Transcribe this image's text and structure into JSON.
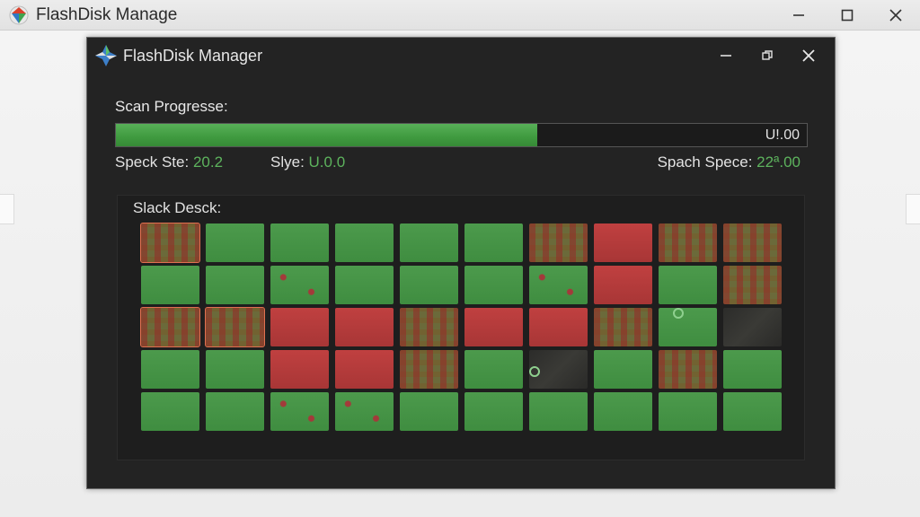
{
  "os_window": {
    "title": "FlashDisk Manage",
    "icon": "flashdisk-app-icon",
    "controls": [
      "minimize-icon",
      "maximize-icon",
      "close-icon"
    ]
  },
  "app_window": {
    "title": "FlashDisk Manager",
    "icon": "flashdisk-app-icon",
    "controls": [
      "minimize-icon",
      "restore-icon",
      "close-icon"
    ]
  },
  "scan": {
    "label": "Scan Progresse:",
    "progress_fraction": 0.61,
    "progress_text": "U!.00"
  },
  "stats": {
    "speck_label": "Speck Ste:",
    "speck_value": "20.2",
    "slye_label": "Slye:",
    "slye_value": "U.0.0",
    "spach_label": "Spach Spece:",
    "spach_value": "22ª.00"
  },
  "slack": {
    "label": "Slack Desck:",
    "rows": [
      [
        "mixed-selected",
        "good",
        "good",
        "good",
        "good",
        "good",
        "mixed",
        "bad",
        "mixed",
        "mixed"
      ],
      [
        "good",
        "good",
        "few",
        "good",
        "good",
        "good",
        "few",
        "bad",
        "good",
        "mixed"
      ],
      [
        "mixed-selected",
        "mixed-selected",
        "bad",
        "bad",
        "mixed",
        "bad",
        "bad",
        "mixed",
        "good",
        "empty"
      ],
      [
        "good",
        "good",
        "bad",
        "bad",
        "mixed",
        "good",
        "empty",
        "good",
        "mixed",
        "good"
      ],
      [
        "good",
        "good",
        "few",
        "few",
        "good",
        "good",
        "good",
        "good",
        "good",
        "good"
      ]
    ]
  },
  "colors": {
    "good": "#4c9a4c",
    "bad": "#c04040",
    "accent_text": "#5db35d",
    "selection_outline": "#e07050"
  }
}
